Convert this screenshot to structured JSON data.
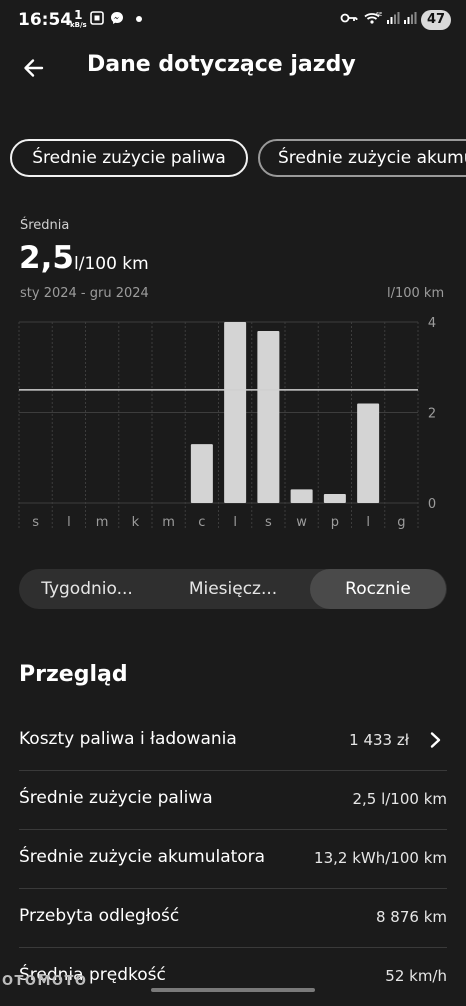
{
  "status_bar": {
    "time": "16:54",
    "net_speed_value": "1",
    "net_speed_unit": "kB/s",
    "battery": "47"
  },
  "header": {
    "title": "Dane dotyczące jazdy"
  },
  "chips": [
    {
      "label": "Średnie zużycie paliwa",
      "active": true
    },
    {
      "label": "Średnie zużycie akumulatora",
      "active": false
    }
  ],
  "summary": {
    "label": "Średnia",
    "value": "2,5",
    "unit": "l/100 km",
    "range": "sty 2024 - gru 2024",
    "axis_unit": "l/100 km"
  },
  "chart_data": {
    "type": "bar",
    "categories": [
      "s",
      "l",
      "m",
      "k",
      "m",
      "c",
      "l",
      "s",
      "w",
      "p",
      "l",
      "g"
    ],
    "values": [
      0,
      0,
      0,
      0,
      0,
      1.3,
      4.0,
      3.8,
      0.3,
      0.2,
      2.2,
      0
    ],
    "average": 2.5,
    "ylim": [
      0,
      4
    ],
    "yticks": [
      "0",
      "2",
      "4"
    ],
    "grid": true,
    "colors": {
      "bar": "#d4d4d4",
      "grid": "#3d3d3d",
      "average_line": "#cfcfcf"
    }
  },
  "period_toggle": {
    "options": [
      "Tygodnio...",
      "Miesięcz...",
      "Rocznie"
    ],
    "selected": "Rocznie"
  },
  "overview": {
    "title": "Przegląd",
    "rows": [
      {
        "label": "Koszty paliwa i ładowania",
        "value": "1 433 zł",
        "chevron": true
      },
      {
        "label": "Średnie zużycie paliwa",
        "value": "2,5 l/100 km"
      },
      {
        "label": "Średnie zużycie akumulatora",
        "value": "13,2 kWh/100 km"
      },
      {
        "label": "Przebyta odległość",
        "value": "8 876 km"
      },
      {
        "label": "Średnia prędkość",
        "value": "52 km/h"
      }
    ]
  },
  "watermark": "OTOMOTO"
}
